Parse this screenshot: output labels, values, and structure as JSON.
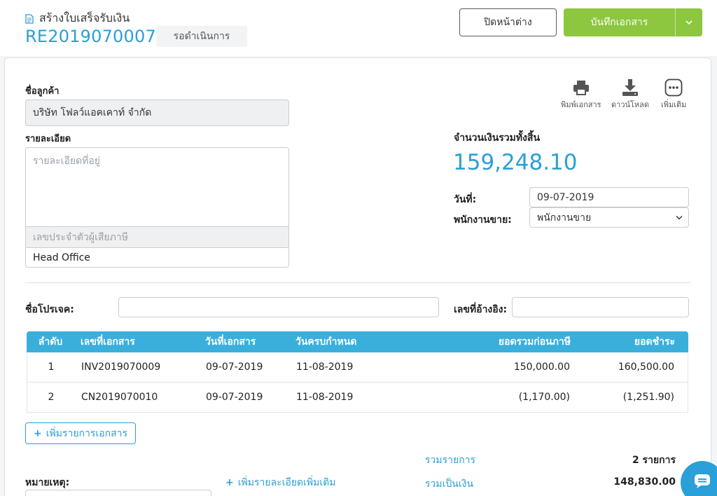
{
  "header": {
    "page_title": "สร้างใบเสร็จรับเงิน",
    "doc_number": "RE2019070007",
    "status": "รอดำเนินการ",
    "close_label": "ปิดหน้าต่าง",
    "save_label": "บันทึกเอกสาร"
  },
  "customer": {
    "name_label": "ชื่อลูกค้า",
    "name_value": "บริษัท โฟลว์แอคเคาท์ จำกัด",
    "details_label": "รายละเอียด",
    "address_placeholder": "รายละเอียดที่อยู่",
    "tax_id_placeholder": "เลขประจำตัวผู้เสียภาษี",
    "branch_value": "Head Office"
  },
  "tools": {
    "print_label": "พิมพ์เอกสาร",
    "download_label": "ดาวน์โหลด",
    "more_label": "เพิ่มเติม"
  },
  "summary_top": {
    "total_label": "จำนวนเงินรวมทั้งสิ้น",
    "total_value": "159,248.10",
    "date_label": "วันที่:",
    "date_value": "09-07-2019",
    "salesperson_label": "พนักงานขาย:",
    "salesperson_value": "พนักงานขาย"
  },
  "project": {
    "project_label": "ชื่อโปรเจค:",
    "reference_label": "เลขที่อ้างอิง:"
  },
  "table": {
    "headers": [
      "ลำดับ",
      "เลขที่เอกสาร",
      "วันที่เอกสาร",
      "วันครบกำหนด",
      "ยอดรวมก่อนภาษี",
      "ยอดชำระ"
    ],
    "rows": [
      {
        "index": "1",
        "doc_no": "INV2019070009",
        "doc_date": "09-07-2019",
        "due_date": "11-08-2019",
        "pre_tax": "150,000.00",
        "payment": "160,500.00"
      },
      {
        "index": "2",
        "doc_no": "CN2019070010",
        "doc_date": "09-07-2019",
        "due_date": "11-08-2019",
        "pre_tax": "(1,170.00)",
        "payment": "(1,251.90)"
      }
    ]
  },
  "footer": {
    "add_doc_label": "เพิ่มรายการเอกสาร",
    "items_total_label": "รวมรายการ",
    "items_total_value": "2 รายการ",
    "amount_total_label": "รวมเป็นเงิน",
    "amount_total_value": "148,830.00",
    "remark_label": "หมายเหตุ:",
    "add_detail_label": "เพิ่มรายละเอียดเพิ่มเติม"
  },
  "icons": {
    "plus": "+",
    "chevron": "⌄"
  },
  "colors": {
    "accent_blue": "#2a9fd8",
    "save_green": "#8dc63f",
    "table_header": "#3aafdc"
  }
}
